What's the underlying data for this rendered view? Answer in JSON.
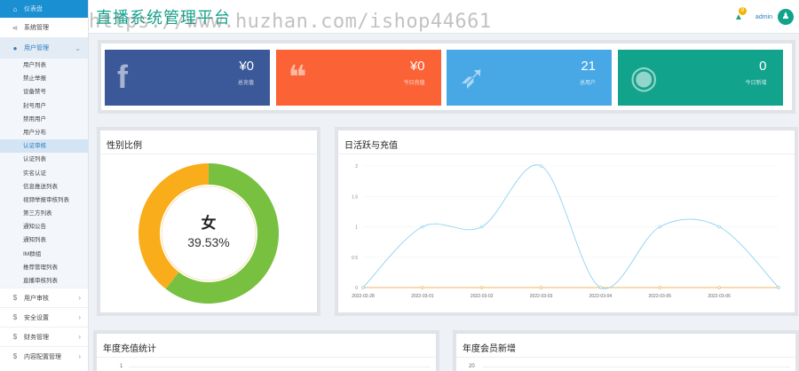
{
  "header": {
    "title": "直播系统管理平台",
    "watermark": "https://www.huzhan.com/ishop44661",
    "notification_count": "8",
    "user": "admin"
  },
  "sidebar": {
    "home": "仪表盘",
    "system": "系统管理",
    "user_mgmt": "用户管理",
    "sub_items": [
      "用户列表",
      "禁止举报",
      "设备禁号",
      "封号用户",
      "禁用用户",
      "用户分布",
      "认证审核",
      "认证列表",
      "实名认证",
      "信息推送列表",
      "视频举报审核列表",
      "第三方列表",
      "通知公告",
      "通知列表",
      "IM群组",
      "推荐管理列表",
      "直播审核列表"
    ],
    "active_sub_index": 6,
    "groups": [
      "用户审核",
      "安全设置",
      "财务管理",
      "内容配置管理"
    ]
  },
  "stats": [
    {
      "icon": "facebook-icon",
      "value": "¥0",
      "label": "总充值",
      "color": "#3b5998"
    },
    {
      "icon": "chat-icon",
      "value": "¥0",
      "label": "今日充值",
      "color": "#fb6236"
    },
    {
      "icon": "twitter-icon",
      "value": "21",
      "label": "总用户",
      "color": "#47a8e5"
    },
    {
      "icon": "eye-icon",
      "value": "0",
      "label": "今日新增",
      "color": "#12a38c"
    }
  ],
  "gender_panel": {
    "title": "性别比例",
    "center_label": "女",
    "center_value": "39.53%",
    "female_pct": 39.53,
    "female_color": "#f9ad1a",
    "male_color": "#78c03f"
  },
  "trend_panel": {
    "title": "日活跃与充值"
  },
  "yearly_recharge": {
    "title": "年度充值统计",
    "y_tick": "1"
  },
  "yearly_members": {
    "title": "年度会员新增",
    "y_tick": "20"
  },
  "chart_data": {
    "type": "line",
    "x": [
      "2022-02-28",
      "2022-03-01",
      "2022-03-02",
      "2022-03-03",
      "2022-03-04",
      "2022-03-05",
      "2022-03-06"
    ],
    "series": [
      {
        "values": [
          0,
          1,
          1,
          2,
          0,
          1,
          1,
          0
        ],
        "color": "#8fd3f0"
      },
      {
        "values": [
          0,
          0,
          0,
          0,
          0,
          0,
          0,
          0
        ],
        "color": "#f0b560"
      }
    ],
    "x_points": [
      "2022-02-28",
      "2022-03-01",
      "2022-03-02",
      "2022-03-03",
      "2022-03-04",
      "2022-03-05",
      "2022-03-06",
      ""
    ],
    "y_ticks": [
      "0",
      "0.5",
      "1",
      "1.5",
      "2"
    ],
    "ylim": [
      0,
      2
    ]
  }
}
